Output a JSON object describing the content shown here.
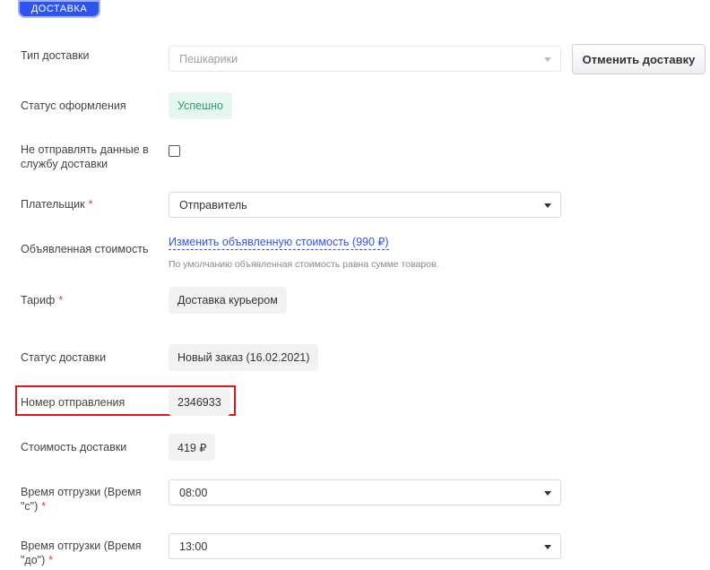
{
  "section": {
    "tab_label": "ДОСТАВКА"
  },
  "delivery_type": {
    "label": "Тип доставки",
    "value": "Пешкарики",
    "cancel_button": "Отменить доставку"
  },
  "registration_status": {
    "label": "Статус оформления",
    "value": "Успешно"
  },
  "do_not_send": {
    "label": "Не отправлять данные в службу доставки",
    "checked": false
  },
  "payer": {
    "label": "Плательщик",
    "required": "*",
    "value": "Отправитель"
  },
  "declared_value": {
    "label": "Объявленная стоимость",
    "link": "Изменить объявленную стоимость (990 ₽)",
    "hint": "По умолчанию объявленная стоимость равна сумме товаров."
  },
  "tariff": {
    "label": "Тариф",
    "required": "*",
    "value": "Доставка курьером"
  },
  "delivery_status": {
    "label": "Статус доставки",
    "value": "Новый заказ (16.02.2021)"
  },
  "tracking_number": {
    "label": "Номер отправления",
    "value": "2346933"
  },
  "delivery_cost": {
    "label": "Стоимость доставки",
    "value": "419 ₽"
  },
  "shipment_from": {
    "label": "Время отгрузки (Время \"с\")",
    "required": "*",
    "value": "08:00"
  },
  "shipment_to": {
    "label": "Время отгрузки (Время \"до\")",
    "required": "*",
    "value": "13:00"
  },
  "colors": {
    "accent": "#2f54eb",
    "success_bg": "#e6f7ef",
    "success_text": "#2e9e6b",
    "required": "#e53935",
    "highlight": "#e3141a"
  }
}
